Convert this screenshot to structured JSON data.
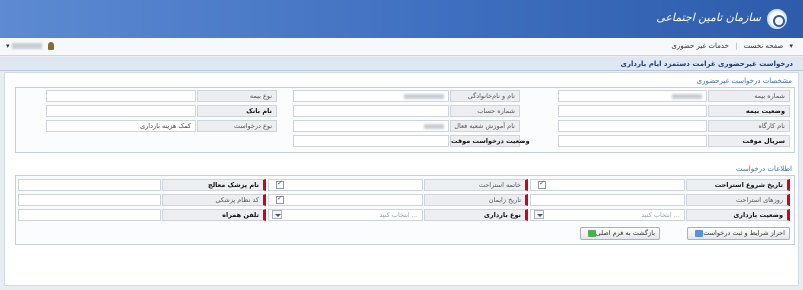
{
  "header": {
    "org_name": "سازمان تامین اجتماعی"
  },
  "nav": {
    "home": "صفحه نخست",
    "item": "خدمات غیر حضوری",
    "user_name": ""
  },
  "page_title": "درخواست غیرحضوری غرامت دستمزد ایام بارداری",
  "request_section": {
    "title": "مشخصات درخواست غیرحضوری",
    "fields": {
      "insurance_no": "شماره بیمه",
      "full_name": "نام و نام‌خانوادگی",
      "insurance_type": "نوع بیمه",
      "insurance_status": "وضعیت بیمه",
      "account_no": "شماره حساب",
      "bank_name": "نام بانک",
      "workshop_name": "نام کارگاه",
      "branch_name": "نام آموزش شعبه فعال",
      "request_type": "نوع درخواست",
      "request_type_value": "کمک هزینه بارداری",
      "tracking_serial": "سریال موقت",
      "request_status": "وضعیت درخواست موقت"
    }
  },
  "info_section": {
    "title": "اطلاعات درخواست",
    "fields": {
      "rest_start_date": "تاریخ شروع استراحت",
      "rest_end": "خاتمه استراحت",
      "doctor_name": "نام پزشک معالج",
      "rest_days": "روزهای استراحت",
      "delivery_date": "تاریخ زایمان",
      "doctor_code": "کد نظام پزشکی",
      "pregnancy_status": "وضعیت بارداری",
      "pregnancy_type": "نوع بارداری",
      "mobile": "تلفن همراه",
      "select_placeholder": "انتخاب کنید ..."
    },
    "buttons": {
      "submit": "احراز شرایط و ثبت درخواست",
      "back": "بازگشت به فرم اصلی"
    }
  },
  "colors": {
    "header": "#3f6fc0",
    "required_marker": "#d0021b",
    "section_title": "#3a6cb5"
  }
}
